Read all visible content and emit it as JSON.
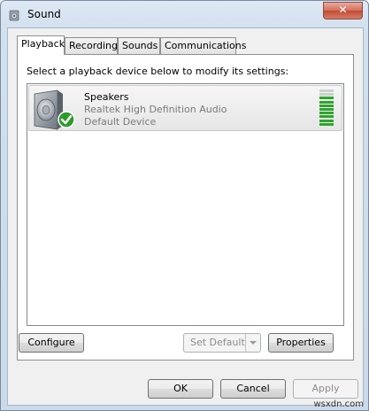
{
  "window": {
    "title": "Sound",
    "close_label": "✕"
  },
  "tabs": [
    {
      "label": "Playback",
      "active": true
    },
    {
      "label": "Recording",
      "active": false
    },
    {
      "label": "Sounds",
      "active": false
    },
    {
      "label": "Communications",
      "active": false
    }
  ],
  "playback": {
    "instruction": "Select a playback device below to modify its settings:",
    "devices": [
      {
        "name": "Speakers",
        "description": "Realtek High Definition Audio",
        "status": "Default Device",
        "icon": "speaker-icon",
        "badge": "green-check-icon",
        "level_meter_active_segments": 8,
        "level_meter_total_segments": 10
      }
    ],
    "configure_label": "Configure",
    "set_default_label": "Set Default",
    "properties_label": "Properties"
  },
  "footer": {
    "ok_label": "OK",
    "cancel_label": "Cancel",
    "apply_label": "Apply"
  },
  "watermark": "wsxdn.com",
  "colors": {
    "meter_active": "#2fa52f",
    "meter_inactive": "#c9d3c9",
    "check_green": "#2e9a2e"
  }
}
